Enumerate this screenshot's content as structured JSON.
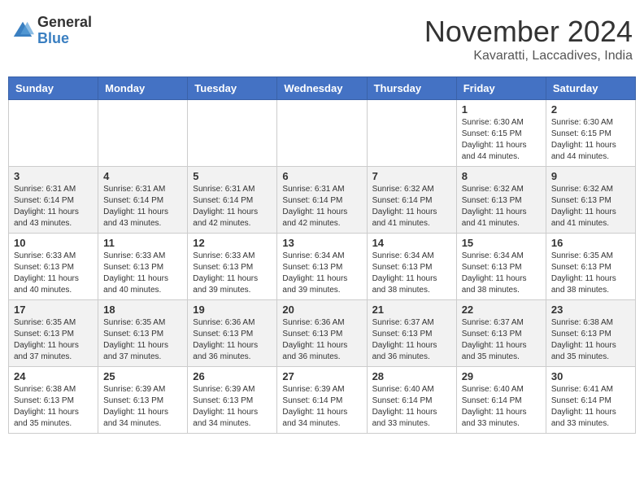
{
  "header": {
    "logo_general": "General",
    "logo_blue": "Blue",
    "month_title": "November 2024",
    "location": "Kavaratti, Laccadives, India"
  },
  "days_of_week": [
    "Sunday",
    "Monday",
    "Tuesday",
    "Wednesday",
    "Thursday",
    "Friday",
    "Saturday"
  ],
  "weeks": [
    [
      {
        "day": "",
        "info": ""
      },
      {
        "day": "",
        "info": ""
      },
      {
        "day": "",
        "info": ""
      },
      {
        "day": "",
        "info": ""
      },
      {
        "day": "",
        "info": ""
      },
      {
        "day": "1",
        "info": "Sunrise: 6:30 AM\nSunset: 6:15 PM\nDaylight: 11 hours\nand 44 minutes."
      },
      {
        "day": "2",
        "info": "Sunrise: 6:30 AM\nSunset: 6:15 PM\nDaylight: 11 hours\nand 44 minutes."
      }
    ],
    [
      {
        "day": "3",
        "info": "Sunrise: 6:31 AM\nSunset: 6:14 PM\nDaylight: 11 hours\nand 43 minutes."
      },
      {
        "day": "4",
        "info": "Sunrise: 6:31 AM\nSunset: 6:14 PM\nDaylight: 11 hours\nand 43 minutes."
      },
      {
        "day": "5",
        "info": "Sunrise: 6:31 AM\nSunset: 6:14 PM\nDaylight: 11 hours\nand 42 minutes."
      },
      {
        "day": "6",
        "info": "Sunrise: 6:31 AM\nSunset: 6:14 PM\nDaylight: 11 hours\nand 42 minutes."
      },
      {
        "day": "7",
        "info": "Sunrise: 6:32 AM\nSunset: 6:14 PM\nDaylight: 11 hours\nand 41 minutes."
      },
      {
        "day": "8",
        "info": "Sunrise: 6:32 AM\nSunset: 6:13 PM\nDaylight: 11 hours\nand 41 minutes."
      },
      {
        "day": "9",
        "info": "Sunrise: 6:32 AM\nSunset: 6:13 PM\nDaylight: 11 hours\nand 41 minutes."
      }
    ],
    [
      {
        "day": "10",
        "info": "Sunrise: 6:33 AM\nSunset: 6:13 PM\nDaylight: 11 hours\nand 40 minutes."
      },
      {
        "day": "11",
        "info": "Sunrise: 6:33 AM\nSunset: 6:13 PM\nDaylight: 11 hours\nand 40 minutes."
      },
      {
        "day": "12",
        "info": "Sunrise: 6:33 AM\nSunset: 6:13 PM\nDaylight: 11 hours\nand 39 minutes."
      },
      {
        "day": "13",
        "info": "Sunrise: 6:34 AM\nSunset: 6:13 PM\nDaylight: 11 hours\nand 39 minutes."
      },
      {
        "day": "14",
        "info": "Sunrise: 6:34 AM\nSunset: 6:13 PM\nDaylight: 11 hours\nand 38 minutes."
      },
      {
        "day": "15",
        "info": "Sunrise: 6:34 AM\nSunset: 6:13 PM\nDaylight: 11 hours\nand 38 minutes."
      },
      {
        "day": "16",
        "info": "Sunrise: 6:35 AM\nSunset: 6:13 PM\nDaylight: 11 hours\nand 38 minutes."
      }
    ],
    [
      {
        "day": "17",
        "info": "Sunrise: 6:35 AM\nSunset: 6:13 PM\nDaylight: 11 hours\nand 37 minutes."
      },
      {
        "day": "18",
        "info": "Sunrise: 6:35 AM\nSunset: 6:13 PM\nDaylight: 11 hours\nand 37 minutes."
      },
      {
        "day": "19",
        "info": "Sunrise: 6:36 AM\nSunset: 6:13 PM\nDaylight: 11 hours\nand 36 minutes."
      },
      {
        "day": "20",
        "info": "Sunrise: 6:36 AM\nSunset: 6:13 PM\nDaylight: 11 hours\nand 36 minutes."
      },
      {
        "day": "21",
        "info": "Sunrise: 6:37 AM\nSunset: 6:13 PM\nDaylight: 11 hours\nand 36 minutes."
      },
      {
        "day": "22",
        "info": "Sunrise: 6:37 AM\nSunset: 6:13 PM\nDaylight: 11 hours\nand 35 minutes."
      },
      {
        "day": "23",
        "info": "Sunrise: 6:38 AM\nSunset: 6:13 PM\nDaylight: 11 hours\nand 35 minutes."
      }
    ],
    [
      {
        "day": "24",
        "info": "Sunrise: 6:38 AM\nSunset: 6:13 PM\nDaylight: 11 hours\nand 35 minutes."
      },
      {
        "day": "25",
        "info": "Sunrise: 6:39 AM\nSunset: 6:13 PM\nDaylight: 11 hours\nand 34 minutes."
      },
      {
        "day": "26",
        "info": "Sunrise: 6:39 AM\nSunset: 6:13 PM\nDaylight: 11 hours\nand 34 minutes."
      },
      {
        "day": "27",
        "info": "Sunrise: 6:39 AM\nSunset: 6:14 PM\nDaylight: 11 hours\nand 34 minutes."
      },
      {
        "day": "28",
        "info": "Sunrise: 6:40 AM\nSunset: 6:14 PM\nDaylight: 11 hours\nand 33 minutes."
      },
      {
        "day": "29",
        "info": "Sunrise: 6:40 AM\nSunset: 6:14 PM\nDaylight: 11 hours\nand 33 minutes."
      },
      {
        "day": "30",
        "info": "Sunrise: 6:41 AM\nSunset: 6:14 PM\nDaylight: 11 hours\nand 33 minutes."
      }
    ]
  ]
}
